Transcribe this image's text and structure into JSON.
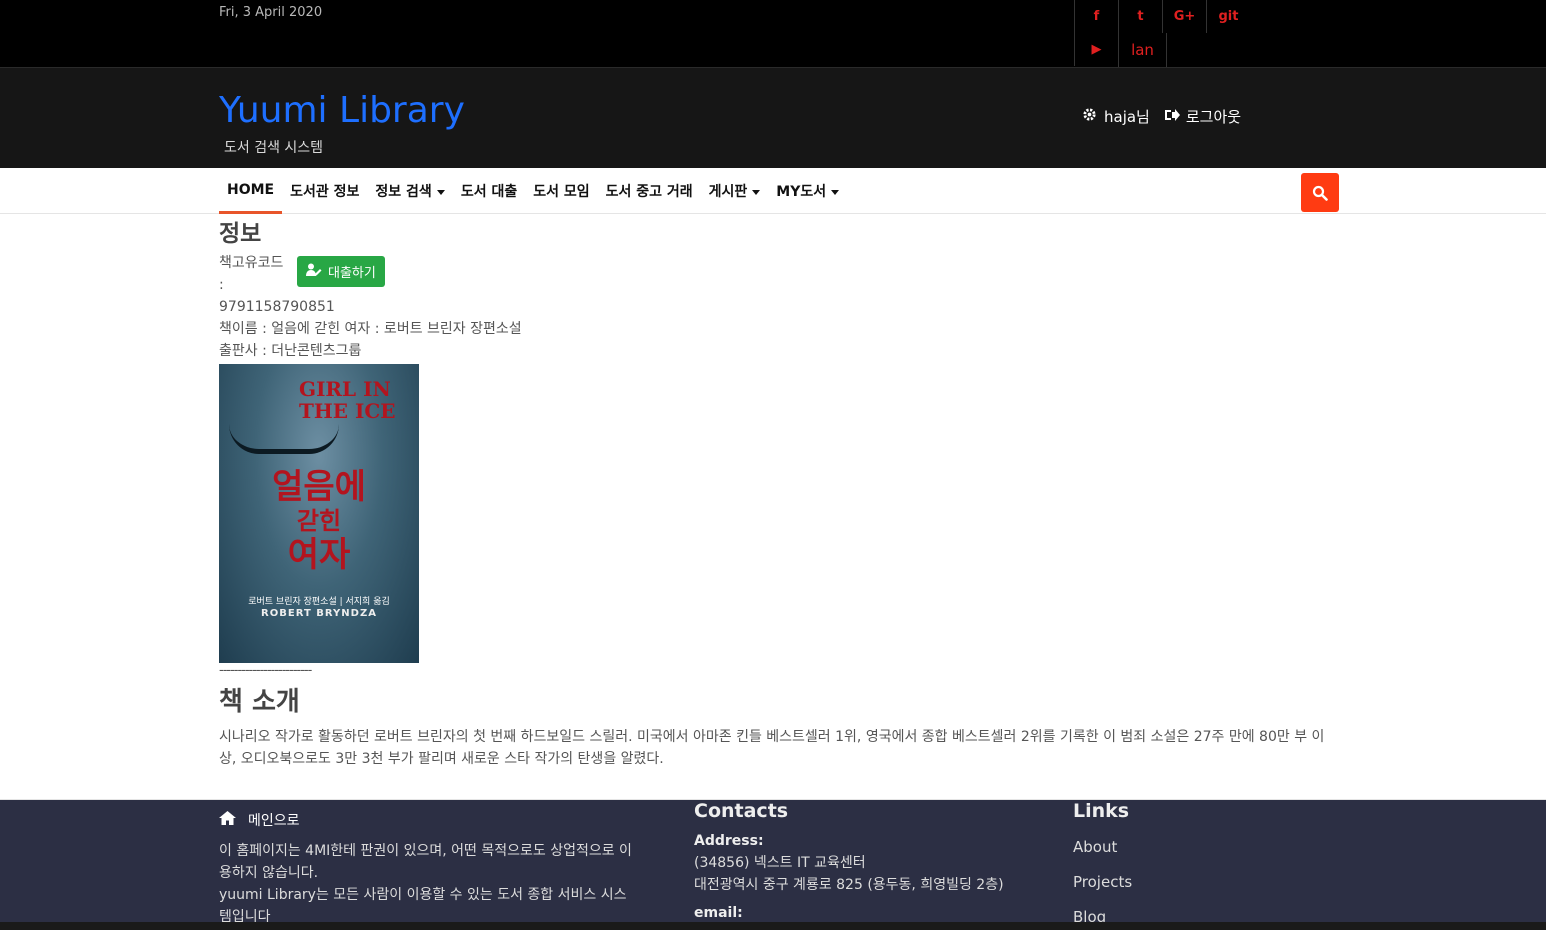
{
  "topbar": {
    "date": "Fri, 3 April 2020",
    "social": [
      {
        "icon": "facebook-icon",
        "glyph": "f"
      },
      {
        "icon": "twitter-icon",
        "glyph": "t"
      },
      {
        "icon": "google-plus-icon",
        "glyph": "G+"
      },
      {
        "icon": "git-icon",
        "glyph": "git"
      },
      {
        "icon": "youtube-icon",
        "glyph": "▶"
      }
    ],
    "lang": "lan"
  },
  "header": {
    "brand": "Yuumi Library",
    "tagline": "도서 검색 시스템",
    "user": "haja님",
    "logout": "로그아웃"
  },
  "nav": {
    "items": [
      {
        "label": "HOME",
        "dropdown": false
      },
      {
        "label": "도서관 정보",
        "dropdown": false
      },
      {
        "label": "정보 검색",
        "dropdown": true
      },
      {
        "label": "도서 대출",
        "dropdown": false
      },
      {
        "label": "도서 모임",
        "dropdown": false
      },
      {
        "label": "도서 중고 거래",
        "dropdown": false
      },
      {
        "label": "게시판",
        "dropdown": true
      },
      {
        "label": "MY도서",
        "dropdown": true
      }
    ]
  },
  "book": {
    "section_title": "정보",
    "code_label": "책고유코드",
    "colon": ":",
    "borrow_button": "대출하기",
    "isbn": "9791158790851",
    "title_line": "책이름 : 얼음에 갇힌 여자 : 로버트 브린자 장편소설",
    "publisher_line": "출판사 : 더난콘텐츠그룹",
    "cover": {
      "en_title": "GIRL IN THE ICE",
      "kr_title_1": "얼음에",
      "kr_title_2": "갇힌",
      "kr_title_3": "여자",
      "subtitle": "로버트 브린자 장편소설 | 서지희 옮김",
      "author": "ROBERT BRYNDZA"
    },
    "divider": "-------------------------",
    "intro_title": "책 소개",
    "intro": "시나리오 작가로 활동하던 로버트 브린자의 첫 번째 하드보일드 스릴러. 미국에서 아마존 킨들 베스트셀러 1위, 영국에서 종합 베스트셀러 2위를 기록한 이 범죄 소설은 27주 만에 80만 부 이상, 오디오북으로도 3만 3천 부가 팔리며 새로운 스타 작가의 탄생을 알렸다."
  },
  "footer": {
    "home_link": "메인으로",
    "copyright_1": "이 홈페이지는 4MI한테 판권이 있으며, 어떤 목적으로도 상업적으로 이용하지 않습니다.",
    "copyright_2": "yuumi Library는 모든 사람이 이용할 수 있는 도서 종합 서비스 시스템입니다",
    "contacts_title": "Contacts",
    "address_label": "Address:",
    "address_1": "(34856) 넥스트 IT 교육센터",
    "address_2": "대전광역시 중구 계룡로 825 (용두동, 희영빌딩 2층)",
    "email_label": "email:",
    "links_title": "Links",
    "links": [
      "About",
      "Projects",
      "Blog"
    ]
  },
  "colors": {
    "brand": "#1e6fff",
    "accent": "#ff3b12",
    "borrow": "#28a745",
    "footer_bg": "#2c2f44"
  }
}
